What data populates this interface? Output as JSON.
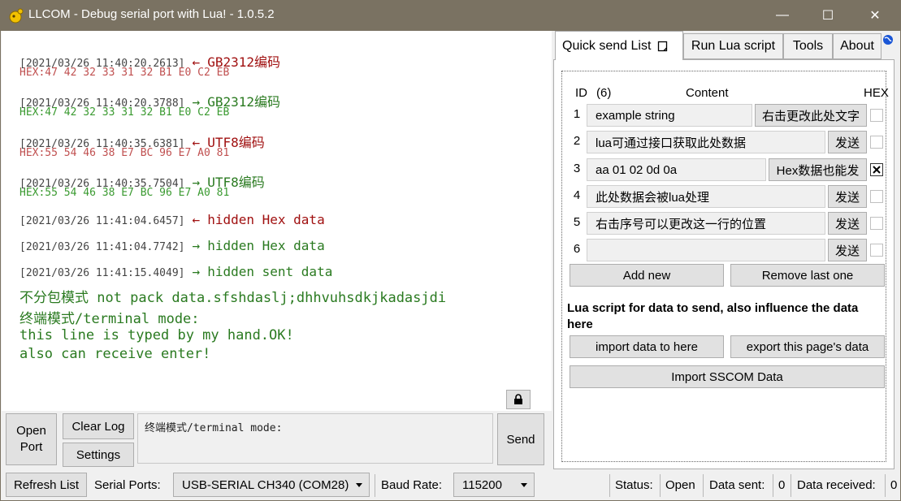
{
  "window": {
    "title": "LLCOM - Debug serial port with Lua! - 1.0.5.2",
    "minimize_glyph": "—",
    "maximize_glyph": "☐",
    "close_glyph": "✕"
  },
  "log": {
    "entries": [
      {
        "time": "[2021/03/26 11:40:20.2613]",
        "arrow": "←",
        "msg": "GB2312编码",
        "hex": "HEX:47 42 32 33 31 32 B1 E0 C2 EB"
      },
      {
        "time": "[2021/03/26 11:40:20.3788]",
        "arrow": "→",
        "msg": "GB2312编码",
        "hex": "HEX:47 42 32 33 31 32 B1 E0 C2 EB"
      },
      {
        "time": "[2021/03/26 11:40:35.6381]",
        "arrow": "←",
        "msg": "UTF8编码",
        "hex": "HEX:55 54 46 38 E7 BC 96 E7 A0 81"
      },
      {
        "time": "[2021/03/26 11:40:35.7504]",
        "arrow": "→",
        "msg": "UTF8编码",
        "hex": "HEX:55 54 46 38 E7 BC 96 E7 A0 81"
      },
      {
        "time": "[2021/03/26 11:41:04.6457]",
        "arrow": "←",
        "msg": "hidden Hex data"
      },
      {
        "time": "[2021/03/26 11:41:04.7742]",
        "arrow": "→",
        "msg": "hidden Hex data"
      },
      {
        "time": "[2021/03/26 11:41:15.4049]",
        "arrow": "→",
        "msg": "hidden sent data"
      }
    ],
    "terminal_lines": [
      "不分包模式 not pack data.sfshdaslj;dhhvuhsdkjkadasjdi",
      "终端模式/terminal mode:",
      "this line is typed by my hand.OK!",
      "also can receive enter!"
    ]
  },
  "controls": {
    "open_port": "Open\nPort",
    "clear_log": "Clear Log",
    "settings": "Settings",
    "send": "Send",
    "send_input_value": "终端模式/terminal mode:",
    "lock_icon": "lock-icon"
  },
  "statusbar": {
    "refresh_list": "Refresh List",
    "serial_ports_label": "Serial Ports:",
    "serial_port_value": "USB-SERIAL CH340 (COM28)",
    "baud_rate_label": "Baud Rate:",
    "baud_rate_value": "115200",
    "status_label": "Status:",
    "status_value": "Open",
    "data_sent_label": "Data sent:",
    "data_sent_value": "0",
    "data_received_label": "Data received:",
    "data_received_value": "0"
  },
  "tabs": [
    "Quick send List",
    "Run Lua script",
    "Tools",
    "About"
  ],
  "quick_send": {
    "header_id": "ID",
    "header_count": "(6)",
    "header_content": "Content",
    "header_hex": "HEX",
    "rows": [
      {
        "id": "1",
        "content": "example string",
        "button": "右击更改此处文字",
        "hex": false
      },
      {
        "id": "2",
        "content": "lua可通过接口获取此处数据",
        "button": "发送",
        "hex": false
      },
      {
        "id": "3",
        "content": "aa 01 02 0d 0a",
        "button": "Hex数据也能发",
        "hex": true
      },
      {
        "id": "4",
        "content": "此处数据会被lua处理",
        "button": "发送",
        "hex": false
      },
      {
        "id": "5",
        "content": "右击序号可以更改这一行的位置",
        "button": "发送",
        "hex": false
      },
      {
        "id": "6",
        "content": "",
        "button": "发送",
        "hex": false
      }
    ],
    "add_new": "Add new",
    "remove_last": "Remove last one",
    "lua_note": "Lua script for data to send, also influence the data here",
    "import_data": "import data to here",
    "export_data": "export this page's data",
    "import_sscom": "Import SSCOM Data"
  },
  "colors": {
    "titlebar": "#7a7262",
    "received": "#a01010",
    "sent": "#2a7a20",
    "accent": "#1a56d6"
  }
}
